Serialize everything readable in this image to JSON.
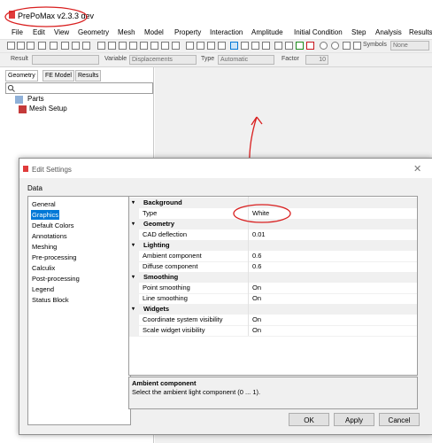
{
  "app": {
    "title": "PrePoMax v2.3.3 dev"
  },
  "menu": [
    "File",
    "Edit",
    "View",
    "Geometry",
    "Mesh",
    "Model",
    "Property",
    "Interaction",
    "Amplitude",
    "Initial Condition",
    "Step",
    "Analysis",
    "Results"
  ],
  "toolbar": {
    "symbols_label": "Symbols",
    "symbols_value": "None",
    "result_label": "Result",
    "variable_label": "Variable",
    "variable_value": "Displacements",
    "type_label": "Type",
    "type_value": "Automatic",
    "factor_label": "Factor",
    "factor_value": "10"
  },
  "left_panel": {
    "tabs": [
      "Geometry",
      "FE Model",
      "Results"
    ],
    "tree": [
      "Parts",
      "Mesh Setup"
    ]
  },
  "dialog": {
    "title": "Edit Settings",
    "group_label": "Data",
    "categories": [
      "General",
      "Graphics",
      "Default Colors",
      "Annotations",
      "Meshing",
      "Pre-processing",
      "Calculix",
      "Post-processing",
      "Legend",
      "Status Block"
    ],
    "selected_category": "Graphics",
    "property_groups": [
      {
        "name": "Background",
        "props": [
          {
            "key": "Type",
            "value": "White"
          }
        ]
      },
      {
        "name": "Geometry",
        "props": [
          {
            "key": "CAD deflection",
            "value": "0.01"
          }
        ]
      },
      {
        "name": "Lighting",
        "props": [
          {
            "key": "Ambient component",
            "value": "0.6"
          },
          {
            "key": "Diffuse component",
            "value": "0.6"
          }
        ]
      },
      {
        "name": "Smoothing",
        "props": [
          {
            "key": "Point smoothing",
            "value": "On"
          },
          {
            "key": "Line smoothing",
            "value": "On"
          }
        ]
      },
      {
        "name": "Widgets",
        "props": [
          {
            "key": "Coordinate system visibility",
            "value": "On"
          },
          {
            "key": "Scale widget visibility",
            "value": "On"
          }
        ]
      }
    ],
    "description": {
      "title": "Ambient component",
      "text": "Select the ambient light component (0 ... 1)."
    },
    "buttons": {
      "ok": "OK",
      "apply": "Apply",
      "cancel": "Cancel"
    }
  },
  "colors": {
    "accent": "#0078d7",
    "annotation": "#d92020"
  }
}
